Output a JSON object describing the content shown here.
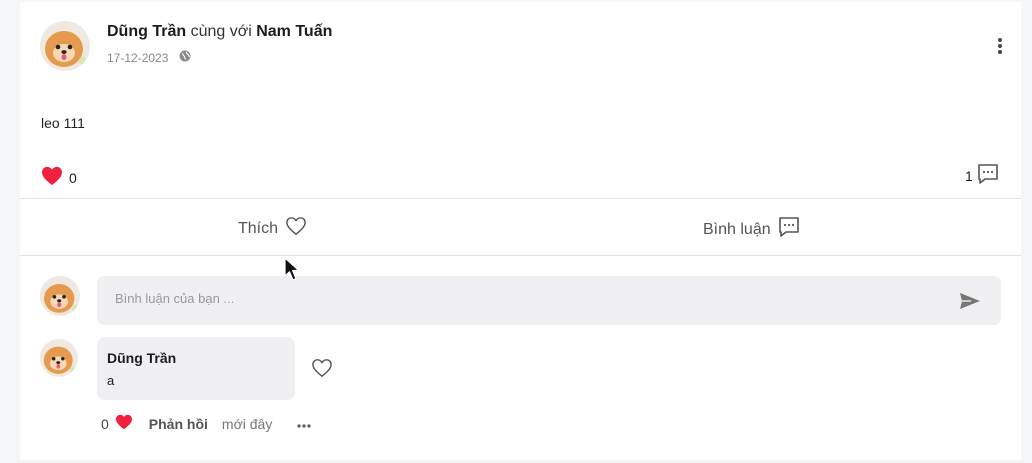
{
  "post": {
    "author": "Dũng Trần",
    "with_text": "cùng với",
    "tagged": "Nam Tuấn",
    "date": "17-12-2023",
    "privacy_icon": "globe-icon",
    "content": "leo 111",
    "like_count": "0",
    "comment_count": "1",
    "like_color": "#f0213f"
  },
  "actions": {
    "like_label": "Thích",
    "comment_label": "Bình luận"
  },
  "comment_box": {
    "placeholder": "Bình luận của bạn ..."
  },
  "comments": [
    {
      "author": "Dũng Trần",
      "text": "a",
      "like_count": "0",
      "reply_label": "Phản hồi",
      "time": "mới đây"
    }
  ]
}
